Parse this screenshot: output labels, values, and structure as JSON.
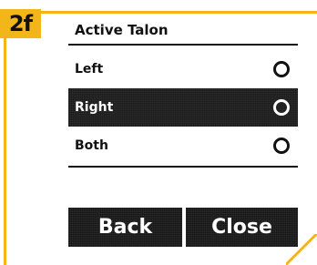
{
  "section_tag": "2f",
  "header": {
    "title": "Active Talon"
  },
  "options": [
    {
      "label": "Left",
      "selected": false
    },
    {
      "label": "Right",
      "selected": true
    },
    {
      "label": "Both",
      "selected": false
    }
  ],
  "buttons": {
    "back_label": "Back",
    "close_label": "Close"
  },
  "colors": {
    "accent": "#f2b51a",
    "dark": "#141414",
    "selected_bg": "#1a1a1a",
    "text": "#111111"
  }
}
